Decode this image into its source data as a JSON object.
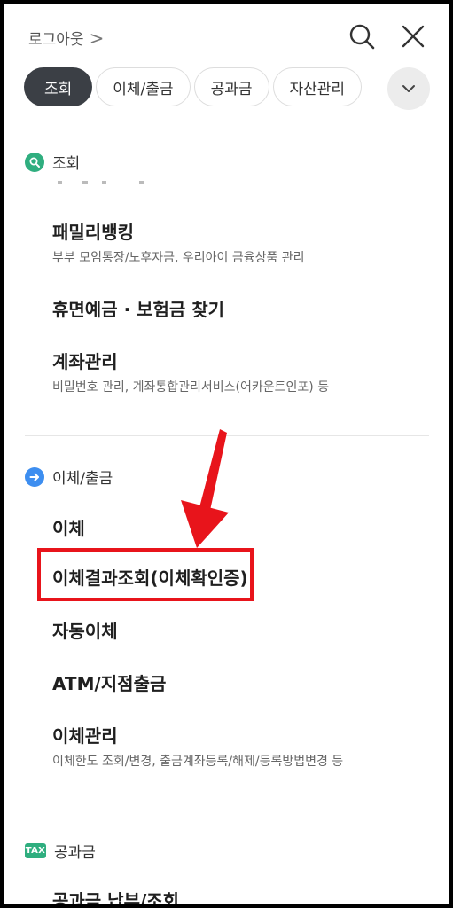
{
  "header": {
    "logout_label": "로그아웃",
    "logout_chevron": ">"
  },
  "icons": {
    "search": "search-icon",
    "close": "close-icon",
    "more": "chevron-down-icon"
  },
  "tabs": [
    {
      "label": "조회",
      "active": true
    },
    {
      "label": "이체/출금",
      "active": false
    },
    {
      "label": "공과금",
      "active": false
    },
    {
      "label": "자산관리",
      "active": false
    }
  ],
  "sections": {
    "inquiry": {
      "title": "조회",
      "items": [
        {
          "label": "패밀리뱅킹",
          "sub": "부부 모임통장/노후자금, 우리아이 금융상품 관리"
        },
        {
          "label": "휴면예금 · 보험금 찾기"
        },
        {
          "label": "계좌관리",
          "sub": "비밀번호 관리, 계좌통합관리서비스(어카운트인포) 등"
        }
      ]
    },
    "transfer": {
      "title": "이체/출금",
      "items": [
        {
          "label": "이체"
        },
        {
          "label": "이체결과조회(이체확인증)"
        },
        {
          "label": "자동이체"
        },
        {
          "label": "ATM/지점출금"
        },
        {
          "label": "이체관리",
          "sub": "이체한도 조회/변경, 출금계좌등록/해제/등록방법변경 등"
        }
      ]
    },
    "utility": {
      "title": "공과금",
      "badge": "TAX",
      "items": [
        {
          "label": "공과금 납부/조회"
        }
      ]
    }
  },
  "colors": {
    "active_tab": "#3b3f45",
    "inquiry_icon": "#2fae7f",
    "transfer_icon": "#3d8ef0",
    "tax_badge": "#2fae7f",
    "highlight": "#e8141b"
  }
}
